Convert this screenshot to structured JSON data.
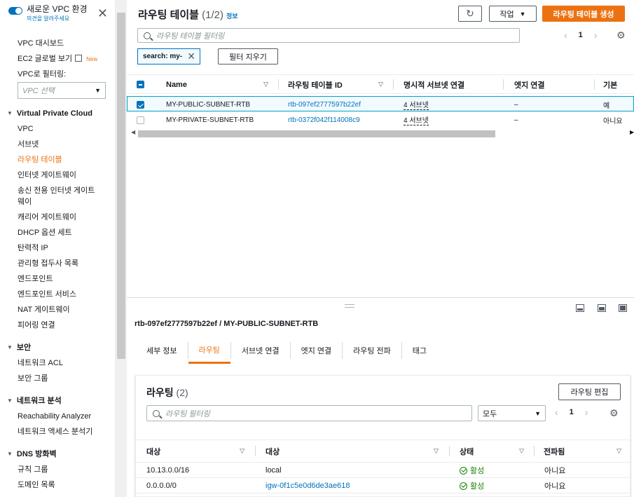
{
  "sidebar": {
    "title": "새로운 VPC 환경",
    "feedback": "의견을 알려주세요",
    "top_links": [
      {
        "label": "VPC 대시보드"
      },
      {
        "label": "EC2 글로벌 보기",
        "badge": "New"
      }
    ],
    "filter_label": "VPC로 필터링:",
    "filter_placeholder": "VPC 선택",
    "sections": [
      {
        "title": "Virtual Private Cloud",
        "items": [
          "VPC",
          "서브넷",
          "라우팅 테이블",
          "인터넷 게이트웨이",
          "송신 전용 인터넷 게이트웨이",
          "캐리어 게이트웨이",
          "DHCP 옵션 세트",
          "탄력적 IP",
          "관리형 접두사 목록",
          "엔드포인트",
          "엔드포인트 서비스",
          "NAT 게이트웨이",
          "피어링 연결"
        ]
      },
      {
        "title": "보안",
        "items": [
          "네트워크 ACL",
          "보안 그룹"
        ]
      },
      {
        "title": "네트워크 분석",
        "items": [
          "Reachability Analyzer",
          "네트워크 액세스 분석기"
        ]
      },
      {
        "title": "DNS 방화벽",
        "items": [
          "규칙 그룹",
          "도메인 목록"
        ]
      }
    ],
    "active_item": "라우팅 테이블"
  },
  "header": {
    "title": "라우팅 테이블",
    "count": "(1/2)",
    "info": "정보",
    "refresh_icon": "refresh-icon",
    "actions_label": "작업",
    "create_label": "라우팅 테이블 생성"
  },
  "filter": {
    "placeholder": "라우팅 테이블 필터링",
    "token": "search: my-",
    "clear_label": "필터 지우기",
    "page": "1"
  },
  "table": {
    "columns": [
      "Name",
      "라우팅 테이블 ID",
      "명시적 서브넷 연결",
      "엣지 연결",
      "기본"
    ],
    "rows": [
      {
        "name": "MY-PUBLIC-SUBNET-RTB",
        "id": "rtb-097ef2777597b22ef",
        "subnets": "4 서브넷",
        "edge": "–",
        "main": "예",
        "selected": true
      },
      {
        "name": "MY-PRIVATE-SUBNET-RTB",
        "id": "rtb-0372f042f114008c9",
        "subnets": "4 서브넷",
        "edge": "–",
        "main": "아니요",
        "selected": false
      }
    ]
  },
  "detail": {
    "title": "rtb-097ef2777597b22ef / MY-PUBLIC-SUBNET-RTB",
    "tabs": [
      "세부 정보",
      "라우팅",
      "서브넷 연결",
      "엣지 연결",
      "라우팅 전파",
      "태그"
    ],
    "active_tab": "라우팅",
    "routes": {
      "title": "라우팅",
      "count": "(2)",
      "edit_label": "라우팅 편집",
      "filter_placeholder": "라우팅 필터링",
      "scope": "모두",
      "page": "1",
      "columns": [
        "대상",
        "대상",
        "상태",
        "전파됨"
      ],
      "rows": [
        {
          "destination": "10.13.0.0/16",
          "target": "local",
          "target_link": false,
          "status": "활성",
          "propagated": "아니요"
        },
        {
          "destination": "0.0.0.0/0",
          "target": "igw-0f1c5e0d6de3ae618",
          "target_link": true,
          "status": "활성",
          "propagated": "아니요"
        }
      ]
    }
  },
  "colors": {
    "accent": "#ec7211",
    "link": "#0073bb",
    "success": "#1d8102"
  }
}
